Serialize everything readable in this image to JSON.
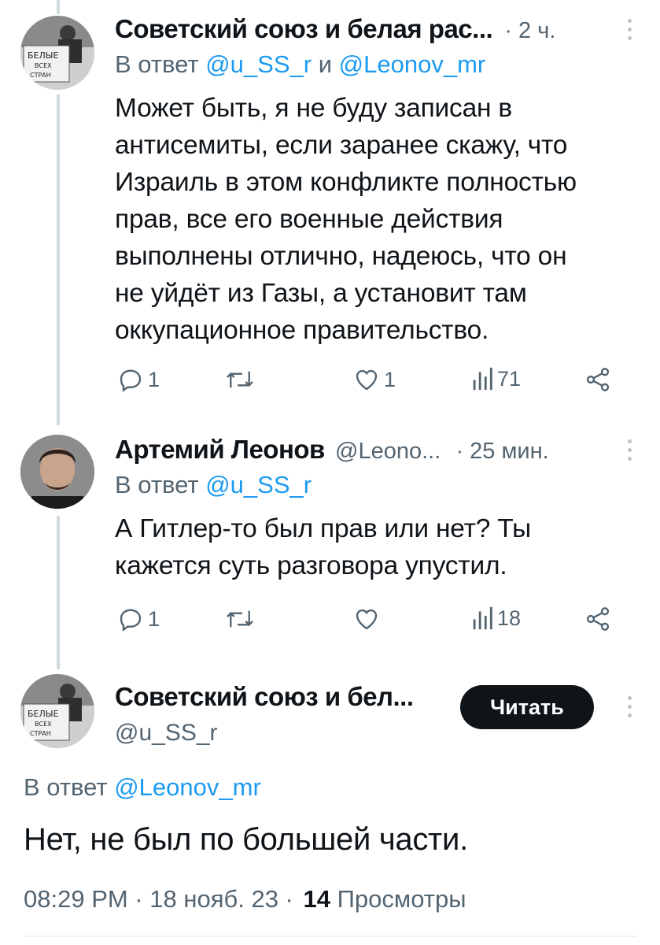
{
  "tweets": [
    {
      "author": "Советский союз и белая рас...",
      "time": "· 2 ч.",
      "reply_prefix": "В ответ",
      "reply_handles": [
        "@u_SS_r",
        "@Leonov_mr"
      ],
      "reply_join": "и",
      "lines": [
        "Может быть, я не буду записан в",
        "антисемиты, если заранее скажу, что",
        "Израиль в этом конфликте полностью",
        "прав, все его военные действия",
        "выполнены отлично, надеюсь, что он",
        "не уйдёт из Газы, а установит там",
        "оккупационное правительство."
      ],
      "replies": "1",
      "retweets": "",
      "likes": "1",
      "views": "71"
    },
    {
      "author": "Артемий Леонов",
      "handle": "@Leono...",
      "time": "· 25 мин.",
      "reply_prefix": "В ответ",
      "reply_handles": [
        "@u_SS_r"
      ],
      "lines": [
        "А Гитлер-то был прав или нет? Ты",
        "кажется суть разговора упустил."
      ],
      "replies": "1",
      "retweets": "",
      "likes": "",
      "views": "18"
    }
  ],
  "main": {
    "author": "Советский союз и бел...",
    "handle": "@u_SS_r",
    "follow_label": "Читать",
    "reply_prefix": "В ответ",
    "reply_handle": "@Leonov_mr",
    "text": "Нет, не был по большей части.",
    "timestamp": "08:29 PM · 18 нояб. 23 ·",
    "views_count": "14",
    "views_label": "Просмотры"
  },
  "avatar_sign": [
    "БЕЛЫЕ",
    "ВСЕХ",
    "СТРАН"
  ],
  "colors": {
    "link": "#1d9bf0",
    "muted": "#536471",
    "text": "#0f1419",
    "thread_line": "#cfd9de"
  },
  "icons": [
    "reply-icon",
    "retweet-icon",
    "like-icon",
    "views-icon",
    "share-icon",
    "more-icon"
  ]
}
